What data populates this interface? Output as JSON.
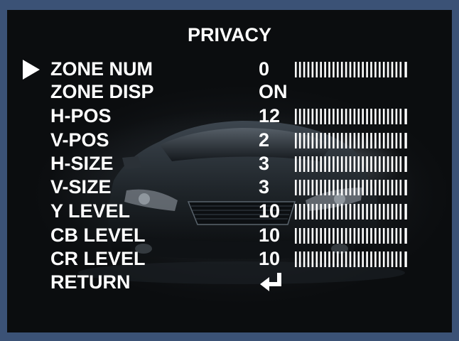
{
  "menu": {
    "title": "PRIVACY",
    "items": [
      {
        "label": "ZONE NUM",
        "value": "0",
        "has_bar": true,
        "selected": true
      },
      {
        "label": "ZONE DISP",
        "value": "ON",
        "has_bar": false,
        "selected": false
      },
      {
        "label": "H-POS",
        "value": "12",
        "has_bar": true,
        "selected": false
      },
      {
        "label": "V-POS",
        "value": "2",
        "has_bar": true,
        "selected": false
      },
      {
        "label": "H-SIZE",
        "value": "3",
        "has_bar": true,
        "selected": false
      },
      {
        "label": "V-SIZE",
        "value": "3",
        "has_bar": true,
        "selected": false
      },
      {
        "label": "Y LEVEL",
        "value": "10",
        "has_bar": true,
        "selected": false
      },
      {
        "label": "CB LEVEL",
        "value": "10",
        "has_bar": true,
        "selected": false
      },
      {
        "label": "CR LEVEL",
        "value": "10",
        "has_bar": true,
        "selected": false
      },
      {
        "label": "RETURN",
        "value": "",
        "has_bar": false,
        "selected": false,
        "icon": "enter-return-icon"
      }
    ]
  },
  "colors": {
    "outer_frame": "#3b5276",
    "osd_text": "#ffffff",
    "background": "#050607"
  },
  "icons": {
    "cursor": "right-triangle-cursor-icon",
    "return": "enter-return-icon"
  }
}
